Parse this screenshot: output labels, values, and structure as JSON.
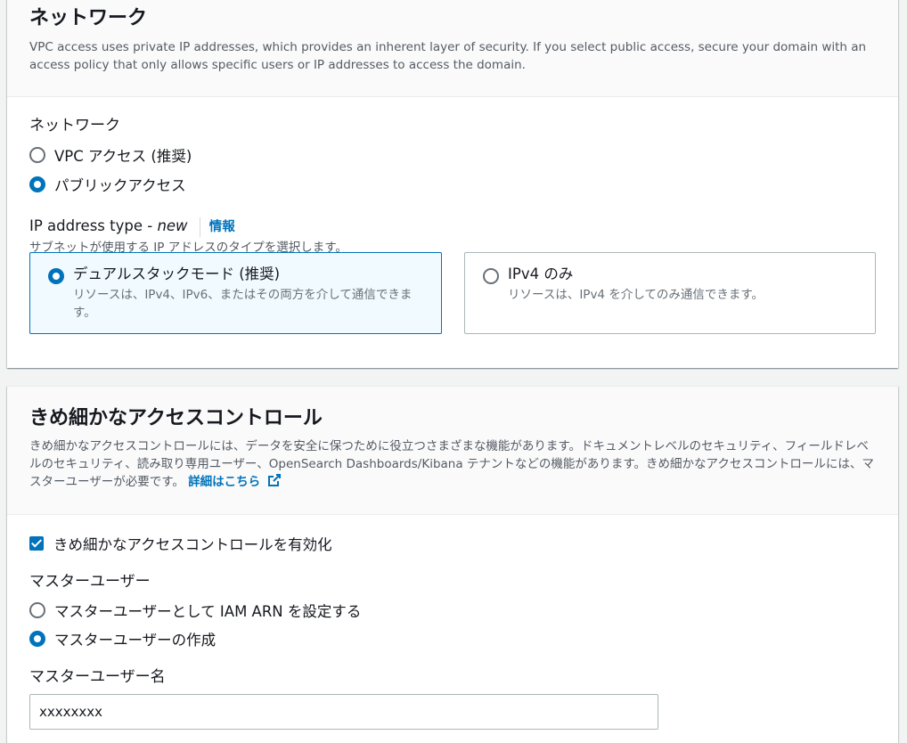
{
  "network": {
    "title": "ネットワーク",
    "description": "VPC access uses private IP addresses, which provides an inherent layer of security. If you select public access, secure your domain with an access policy that only allows specific users or IP addresses to access the domain.",
    "field_label": "ネットワーク",
    "options": [
      {
        "label": "VPC アクセス (推奨)",
        "checked": false
      },
      {
        "label": "パブリックアクセス",
        "checked": true
      }
    ],
    "ip_type": {
      "label": "IP address type - ",
      "label_new": "new",
      "info_link": "情報",
      "hint": "サブネットが使用する IP アドレスのタイプを選択します。",
      "cards": [
        {
          "title": "デュアルスタックモード (推奨)",
          "desc": "リソースは、IPv4、IPv6、またはその両方を介して通信できます。",
          "selected": true
        },
        {
          "title": "IPv4 のみ",
          "desc": "リソースは、IPv4 を介してのみ通信できます。",
          "selected": false
        }
      ]
    }
  },
  "fgac": {
    "title": "きめ細かなアクセスコントロール",
    "description": "きめ細かなアクセスコントロールには、データを安全に保つために役立つさまざまな機能があります。ドキュメントレベルのセキュリティ、フィールドレベルのセキュリティ、読み取り専用ユーザー、OpenSearch Dashboards/Kibana テナントなどの機能があります。きめ細かなアクセスコントロールには、マスターユーザーが必要です。",
    "learn_more": "詳細はこちら",
    "enable_checkbox": "きめ細かなアクセスコントロールを有効化",
    "master_user_label": "マスターユーザー",
    "master_options": [
      {
        "label": "マスターユーザーとして IAM ARN を設定する",
        "checked": false
      },
      {
        "label": "マスターユーザーの作成",
        "checked": true
      }
    ],
    "master_username_label": "マスターユーザー名",
    "master_username_value": "xxxxxxxx"
  },
  "colors": {
    "accent": "#0073bb",
    "selected_bg": "#f1faff",
    "border": "#aab7b8",
    "muted": "#545b64"
  }
}
